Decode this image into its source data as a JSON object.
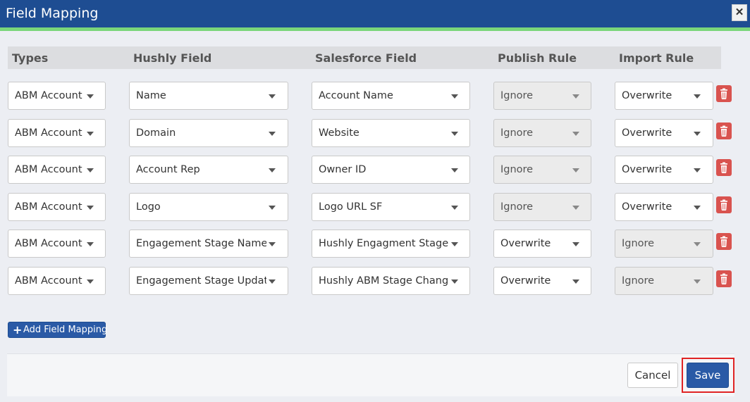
{
  "dialog": {
    "title": "Field Mapping",
    "close_icon": "close-icon",
    "colors": {
      "title_bar": "#1e4d92",
      "accent": "#7ad67a",
      "delete": "#d9534f",
      "primary": "#2a5aa6",
      "highlight": "#e02424"
    }
  },
  "table": {
    "headers": {
      "types": "Types",
      "hushly_field": "Hushly Field",
      "salesforce_field": "Salesforce Field",
      "publish_rule": "Publish Rule",
      "import_rule": "Import Rule"
    },
    "rows": [
      {
        "type": "ABM Account",
        "hushly_field": "Name",
        "salesforce_field": "Account Name",
        "publish_rule": "Ignore",
        "publish_disabled": true,
        "import_rule": "Overwrite",
        "import_disabled": false
      },
      {
        "type": "ABM Account",
        "hushly_field": "Domain",
        "salesforce_field": "Website",
        "publish_rule": "Ignore",
        "publish_disabled": true,
        "import_rule": "Overwrite",
        "import_disabled": false
      },
      {
        "type": "ABM Account",
        "hushly_field": "Account Rep",
        "salesforce_field": "Owner ID",
        "publish_rule": "Ignore",
        "publish_disabled": true,
        "import_rule": "Overwrite",
        "import_disabled": false
      },
      {
        "type": "ABM Account",
        "hushly_field": "Logo",
        "salesforce_field": "Logo URL SF",
        "publish_rule": "Ignore",
        "publish_disabled": true,
        "import_rule": "Overwrite",
        "import_disabled": false
      },
      {
        "type": "ABM Account",
        "hushly_field": "Engagement Stage Name",
        "salesforce_field": "Hushly Engagment Stage",
        "publish_rule": "Overwrite",
        "publish_disabled": false,
        "import_rule": "Ignore",
        "import_disabled": true
      },
      {
        "type": "ABM Account",
        "hushly_field": "Engagement Stage Updated On",
        "salesforce_field": "Hushly ABM Stage Change Date",
        "publish_rule": "Overwrite",
        "publish_disabled": false,
        "import_rule": "Ignore",
        "import_disabled": true
      }
    ],
    "delete_icon": "trash-icon"
  },
  "actions": {
    "add_label": "Add Field Mapping",
    "cancel_label": "Cancel",
    "save_label": "Save"
  }
}
